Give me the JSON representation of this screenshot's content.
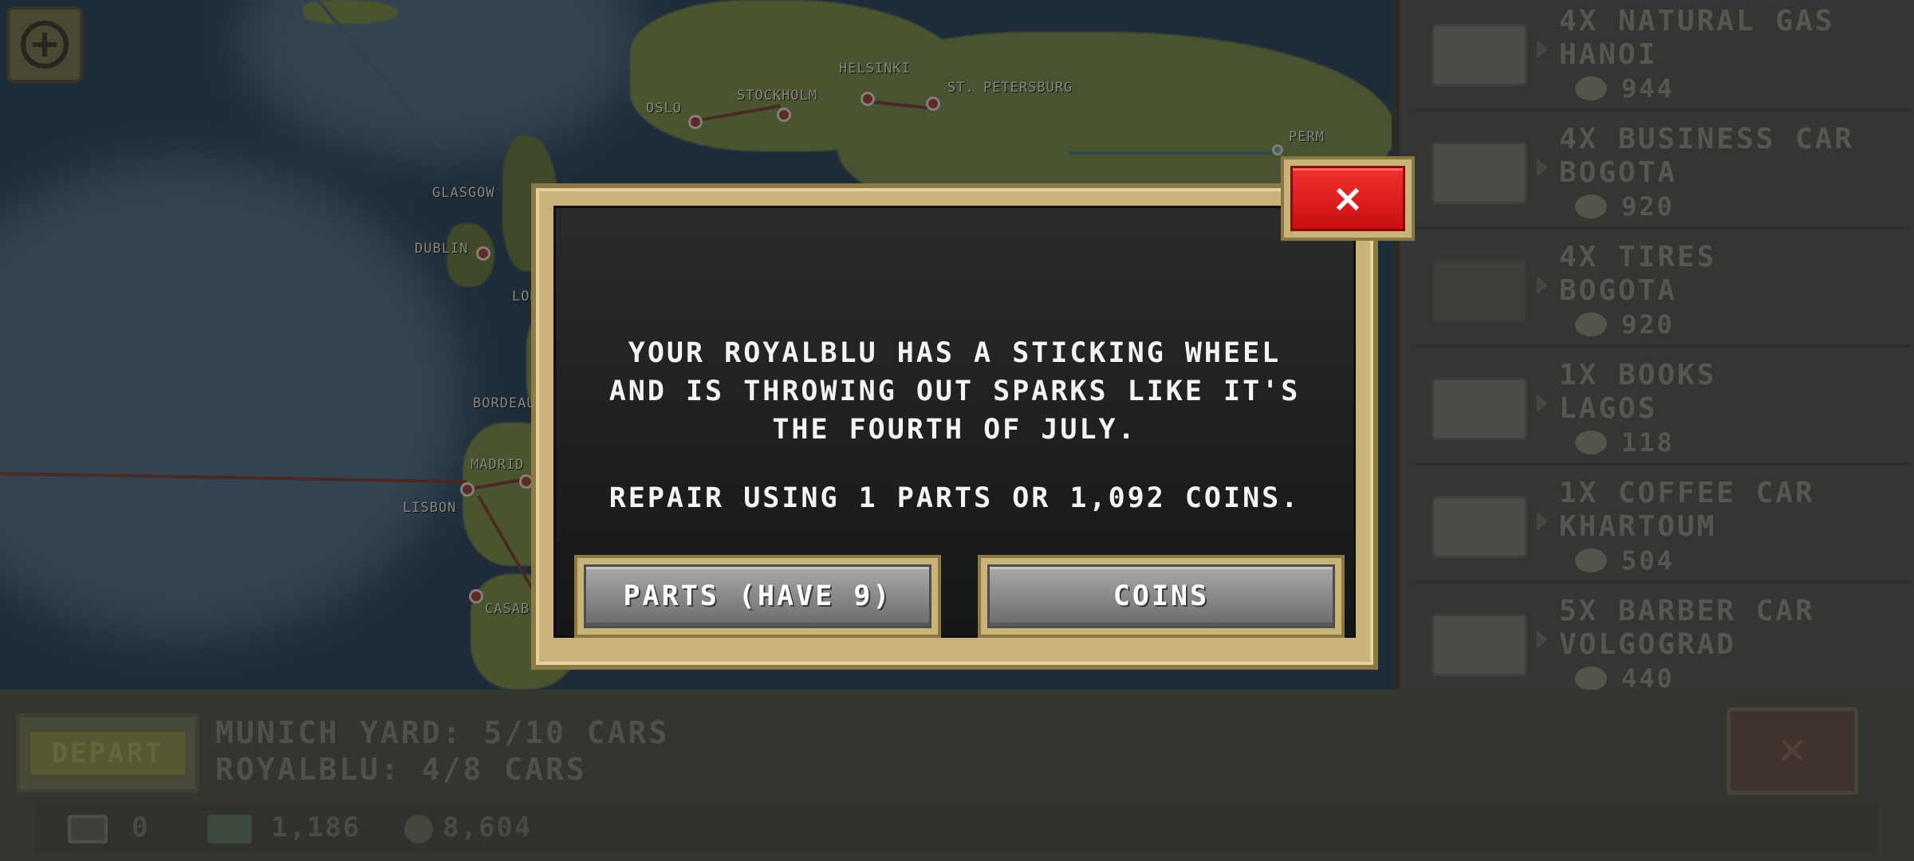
{
  "map": {
    "cities": [
      {
        "name": "OSLO"
      },
      {
        "name": "STOCKHOLM"
      },
      {
        "name": "HELSINKI"
      },
      {
        "name": "ST. PETERSBURG"
      },
      {
        "name": "PERM"
      },
      {
        "name": "GLASGOW"
      },
      {
        "name": "DUBLIN"
      },
      {
        "name": "LONDON"
      },
      {
        "name": "BORDEAUX"
      },
      {
        "name": "MADRID"
      },
      {
        "name": "LISBON"
      },
      {
        "name": "CASABLANCA"
      }
    ]
  },
  "cargo_panel": {
    "items": [
      {
        "title": "4X NATURAL GAS",
        "city": "HANOI",
        "price": "944"
      },
      {
        "title": "4X BUSINESS CAR",
        "city": "BOGOTA",
        "price": "920"
      },
      {
        "title": "4X TIRES",
        "city": "BOGOTA",
        "price": "920"
      },
      {
        "title": "1X BOOKS",
        "city": "LAGOS",
        "price": "118"
      },
      {
        "title": "1X COFFEE CAR",
        "city": "KHARTOUM",
        "price": "504"
      },
      {
        "title": "5X BARBER CAR",
        "city": "VOLGOGRAD",
        "price": "440"
      }
    ]
  },
  "bottom_bar": {
    "depart_label": "DEPART",
    "yard_status": "MUNICH YARD: 5/10 CARS",
    "train_status": "ROYALBLU: 4/8 CARS",
    "close_label": "×",
    "stats": {
      "parts": "0",
      "cash": "1,186",
      "coins": "8,604"
    }
  },
  "dialog": {
    "message_lines": [
      "YOUR ROYALBLU HAS A STICKING WHEEL",
      "AND IS THROWING OUT SPARKS LIKE IT'S",
      "THE FOURTH OF JULY."
    ],
    "repair_text": "REPAIR USING 1 PARTS OR 1,092 COINS.",
    "parts_button": "PARTS (HAVE 9)",
    "coins_button": "COINS",
    "close_label": "×"
  },
  "colors": {
    "dialog_frame": "#c9b37a",
    "dialog_body": "#1e1e1e",
    "close_red": "#e0201c",
    "button_gray": "#8c8c8c"
  }
}
